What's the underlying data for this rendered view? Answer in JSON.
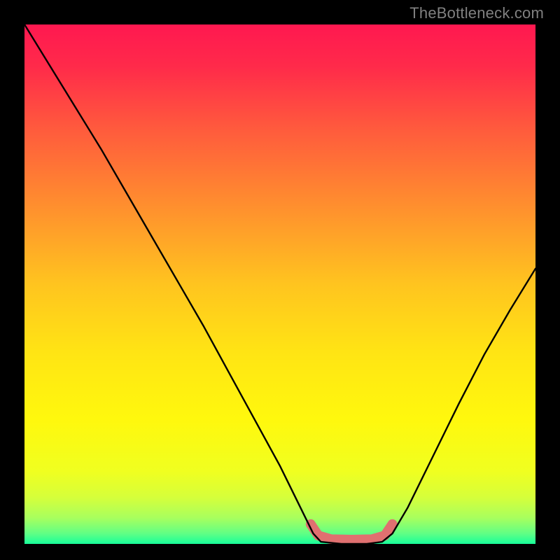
{
  "watermark": "TheBottleneck.com",
  "gradient": {
    "stops": [
      {
        "offset": 0.0,
        "color": "#ff1850"
      },
      {
        "offset": 0.08,
        "color": "#ff2a4a"
      },
      {
        "offset": 0.2,
        "color": "#ff5a3d"
      },
      {
        "offset": 0.35,
        "color": "#ff8f2e"
      },
      {
        "offset": 0.5,
        "color": "#ffc41f"
      },
      {
        "offset": 0.63,
        "color": "#ffe414"
      },
      {
        "offset": 0.76,
        "color": "#fff80d"
      },
      {
        "offset": 0.86,
        "color": "#f0ff20"
      },
      {
        "offset": 0.91,
        "color": "#d6ff3a"
      },
      {
        "offset": 0.95,
        "color": "#a8ff5e"
      },
      {
        "offset": 0.98,
        "color": "#60ff85"
      },
      {
        "offset": 1.0,
        "color": "#18ff9a"
      }
    ]
  },
  "chart_data": {
    "type": "line",
    "title": "",
    "xlabel": "",
    "ylabel": "",
    "xlim": [
      0,
      100
    ],
    "ylim": [
      0,
      100
    ],
    "categories_note": "x is horizontal position 0-100, y is vertical 0=bottom 100=top; curve drawn on top of gradient",
    "series": [
      {
        "name": "curve",
        "color": "#000000",
        "points": [
          {
            "x": 0.0,
            "y": 100.0
          },
          {
            "x": 5.0,
            "y": 92.0
          },
          {
            "x": 10.0,
            "y": 84.0
          },
          {
            "x": 15.0,
            "y": 76.0
          },
          {
            "x": 20.0,
            "y": 67.5
          },
          {
            "x": 25.0,
            "y": 59.0
          },
          {
            "x": 30.0,
            "y": 50.5
          },
          {
            "x": 35.0,
            "y": 42.0
          },
          {
            "x": 40.0,
            "y": 33.0
          },
          {
            "x": 45.0,
            "y": 24.0
          },
          {
            "x": 50.0,
            "y": 15.0
          },
          {
            "x": 54.0,
            "y": 7.0
          },
          {
            "x": 56.5,
            "y": 2.0
          },
          {
            "x": 58.0,
            "y": 0.4
          },
          {
            "x": 62.0,
            "y": 0.0
          },
          {
            "x": 67.0,
            "y": 0.0
          },
          {
            "x": 70.0,
            "y": 0.4
          },
          {
            "x": 72.0,
            "y": 2.0
          },
          {
            "x": 75.0,
            "y": 7.0
          },
          {
            "x": 80.0,
            "y": 17.0
          },
          {
            "x": 85.0,
            "y": 27.0
          },
          {
            "x": 90.0,
            "y": 36.5
          },
          {
            "x": 95.0,
            "y": 45.0
          },
          {
            "x": 100.0,
            "y": 53.0
          }
        ]
      },
      {
        "name": "bottom-accent",
        "color": "#e07070",
        "thick": true,
        "points": [
          {
            "x": 56.0,
            "y": 3.8
          },
          {
            "x": 57.5,
            "y": 1.6
          },
          {
            "x": 60.0,
            "y": 0.9
          },
          {
            "x": 64.0,
            "y": 0.8
          },
          {
            "x": 68.0,
            "y": 0.9
          },
          {
            "x": 70.5,
            "y": 1.6
          },
          {
            "x": 72.0,
            "y": 3.8
          }
        ]
      }
    ]
  }
}
